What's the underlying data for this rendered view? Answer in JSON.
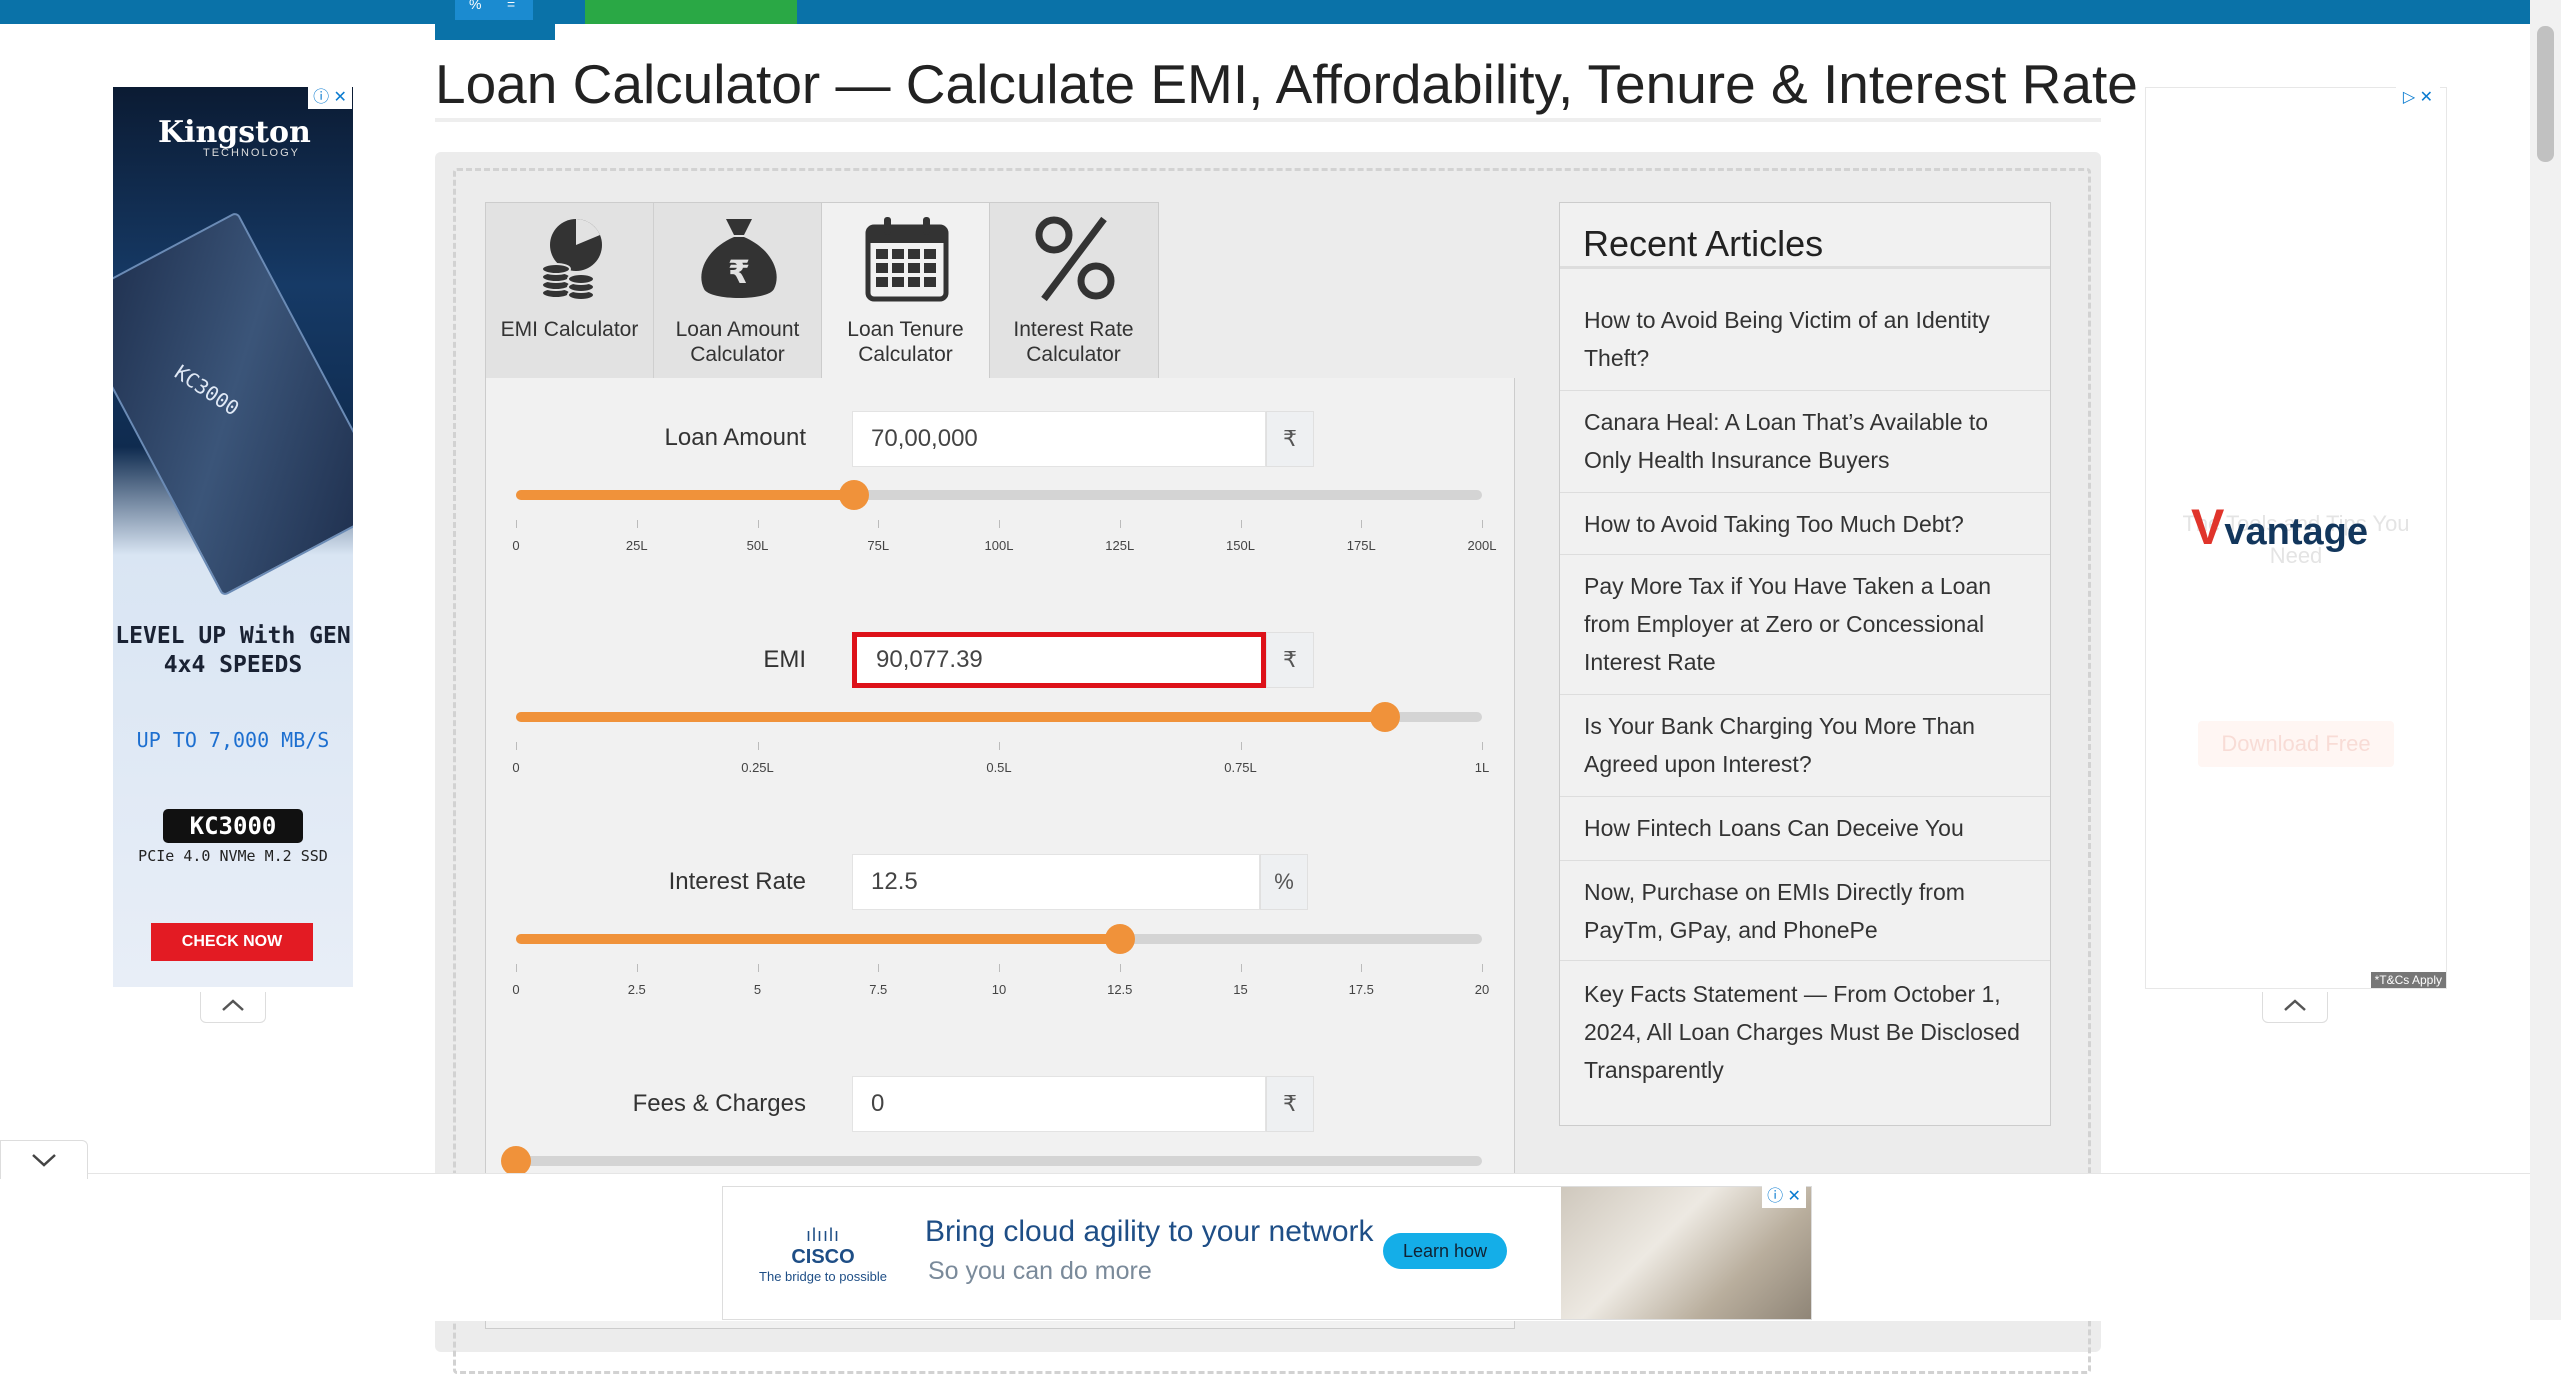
{
  "page": {
    "title": "Loan Calculator — Calculate EMI, Affordability, Tenure & Interest Rate"
  },
  "topbar": {
    "logo_glyph_a": "%",
    "logo_glyph_b": "="
  },
  "tabs": [
    {
      "label": "EMI Calculator",
      "icon": "coins-chart-icon"
    },
    {
      "label": "Loan Amount Calculator",
      "icon": "money-bag-rupee-icon"
    },
    {
      "label": "Loan Tenure Calculator",
      "icon": "calendar-icon"
    },
    {
      "label": "Interest Rate Calculator",
      "icon": "percent-icon"
    }
  ],
  "form": {
    "loan_amount": {
      "label": "Loan Amount",
      "value": "70,00,000",
      "unit": "₹",
      "slider_fraction": 0.35,
      "ticks": [
        "0",
        "25L",
        "50L",
        "75L",
        "100L",
        "125L",
        "150L",
        "175L",
        "200L"
      ]
    },
    "emi": {
      "label": "EMI",
      "value": "90,077.39",
      "unit": "₹",
      "slider_fraction": 0.9,
      "ticks": [
        "0",
        "0.25L",
        "0.5L",
        "0.75L",
        "1L"
      ]
    },
    "interest_rate": {
      "label": "Interest Rate",
      "value": "12.5",
      "unit": "%",
      "slider_fraction": 0.625,
      "ticks": [
        "0",
        "2.5",
        "5",
        "7.5",
        "10",
        "12.5",
        "15",
        "17.5",
        "20"
      ]
    },
    "fees": {
      "label": "Fees & Charges",
      "value": "0",
      "unit": "₹",
      "slider_fraction": 0.0
    }
  },
  "recent_articles": {
    "heading": "Recent Articles",
    "items": [
      "How to Avoid Being Victim of an Identity Theft?",
      "Canara Heal: A Loan That’s Available to Only Health Insurance Buyers",
      "How to Avoid Taking Too Much Debt?",
      "Pay More Tax if You Have Taken a Loan from Employer at Zero or Concessional Interest Rate",
      "Is Your Bank Charging You More Than Agreed upon Interest?",
      "How Fintech Loans Can Deceive You",
      "Now, Purchase on EMIs Directly from PayTm, GPay, and PhonePe",
      "Key Facts Statement — From October 1, 2024, All Loan Charges Must Be Disclosed Transparently"
    ]
  },
  "ads": {
    "left": {
      "brand": "Kingston",
      "brand_sub": "TECHNOLOGY",
      "product_text": "KC3000",
      "headline": "LEVEL UP With GEN 4x4 SPEEDS",
      "speed": "UP TO 7,000 MB/S",
      "model": "KC3000",
      "spec": "PCIe 4.0 NVMe M.2 SSD",
      "cta": "CHECK NOW"
    },
    "right": {
      "brand": "vantage",
      "ghost_text": "The Tools and Tips You Need",
      "ghost_button": "Download Free",
      "terms": "*T&Cs Apply"
    },
    "bottom": {
      "brand": "CISCO",
      "tagline": "The bridge to possible",
      "headline": "Bring cloud agility to your network",
      "subline": "So you can do more",
      "cta": "Learn how"
    }
  },
  "colors": {
    "accent": "#f0923a",
    "topbar": "#0a72a8",
    "focus": "#dd1119"
  }
}
